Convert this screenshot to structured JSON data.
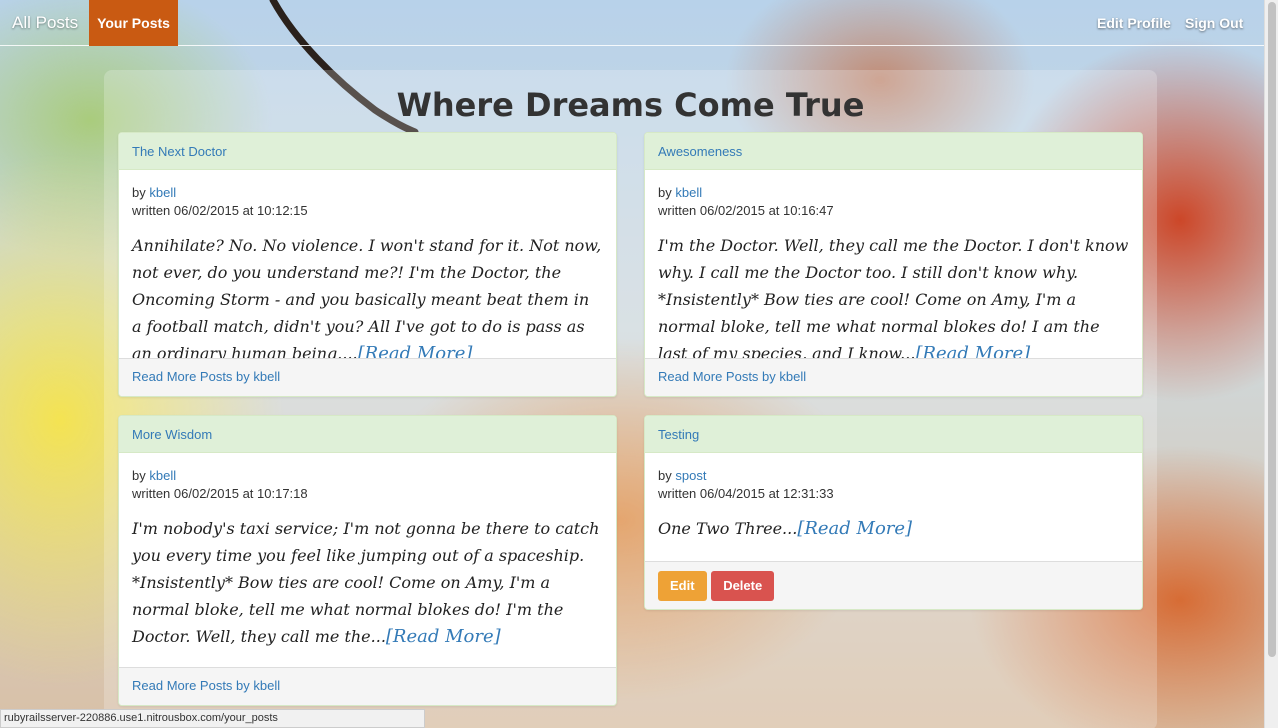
{
  "navbar": {
    "brand": "All Posts",
    "active_link": "Your Posts",
    "edit_profile": "Edit Profile",
    "sign_out": "Sign Out"
  },
  "page": {
    "title": "Where Dreams Come True"
  },
  "posts": [
    {
      "title": "The Next Doctor",
      "by_prefix": "by",
      "author": "kbell",
      "written": "written 06/02/2015 at 10:12:15",
      "excerpt": "Annihilate? No. No violence. I won't stand for it. Not now, not ever, do you understand me?! I'm the Doctor, the Oncoming Storm - and you basically meant beat them in a football match, didn't you? All I've got to do is pass as an ordinary human being....",
      "read_more": "[Read More]",
      "footer_link": "Read More Posts by kbell"
    },
    {
      "title": "Awesomeness",
      "by_prefix": "by",
      "author": "kbell",
      "written": "written 06/02/2015 at 10:16:47",
      "excerpt": "I'm the Doctor. Well, they call me the Doctor. I don't know why. I call me the Doctor too. I still don't know why. *Insistently* Bow ties are cool! Come on Amy, I'm a normal bloke, tell me what normal blokes do! I am the last of my species, and I know...",
      "read_more": "[Read More]",
      "footer_link": "Read More Posts by kbell"
    },
    {
      "title": "More Wisdom",
      "by_prefix": "by",
      "author": "kbell",
      "written": "written 06/02/2015 at 10:17:18",
      "excerpt": "I'm nobody's taxi service; I'm not gonna be there to catch you every time you feel like jumping out of a spaceship. *Insistently* Bow ties are cool! Come on Amy, I'm a normal bloke, tell me what normal blokes do! I'm the Doctor. Well, they call me the...",
      "read_more": "[Read More]",
      "footer_link": "Read More Posts by kbell"
    },
    {
      "title": "Testing",
      "by_prefix": "by",
      "author": "spost",
      "written": "written 06/04/2015 at 12:31:33",
      "excerpt": "One Two Three...",
      "read_more": "[Read More]",
      "edit_button": "Edit",
      "delete_button": "Delete"
    }
  ],
  "status_bar": {
    "url": "rubyrailsserver-220886.use1.nitrousbox.com/your_posts"
  }
}
